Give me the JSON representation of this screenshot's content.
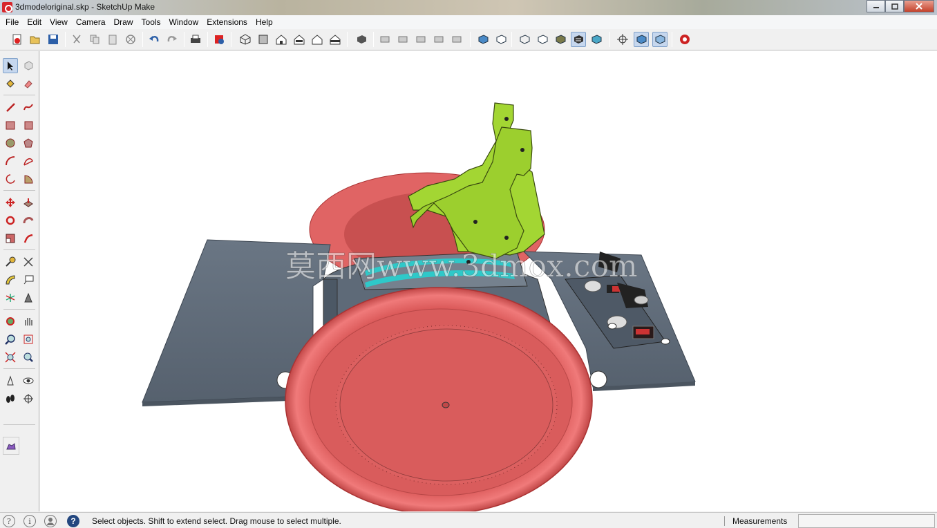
{
  "window": {
    "title": "3dmodeloriginal.skp - SketchUp Make",
    "buttons": [
      "minimize",
      "maximize",
      "close"
    ]
  },
  "menu": [
    "File",
    "Edit",
    "View",
    "Camera",
    "Draw",
    "Tools",
    "Window",
    "Extensions",
    "Help"
  ],
  "toolbar": {
    "groups": [
      [
        "new-icon",
        "open-icon",
        "save-icon"
      ],
      [
        "cut-icon",
        "copy-icon",
        "paste-icon",
        "erase-icon"
      ],
      [
        "undo-icon",
        "redo-icon"
      ],
      [
        "print-icon"
      ],
      [
        "model-info-icon"
      ],
      [
        "iso-view-icon",
        "top-view-icon",
        "front-view-icon",
        "right-view-icon",
        "back-view-icon",
        "left-view-icon"
      ],
      [
        "components-icon"
      ],
      [
        "tools-1-icon",
        "tools-2-icon",
        "tools-3-icon",
        "tools-4-icon",
        "tools-5-icon"
      ],
      [
        "xray-icon",
        "back-edges-icon"
      ],
      [
        "wireframe-icon",
        "hidden-line-icon",
        "shaded-icon",
        "shaded-textures-icon",
        "monochrome-icon"
      ],
      [
        "section-plane-icon",
        "display-section-planes-icon",
        "display-section-cuts-icon"
      ],
      [
        "extension-warehouse-icon"
      ]
    ]
  },
  "lefttoolbar": {
    "tools": [
      "select-icon",
      "make-component-icon",
      "paint-bucket-icon",
      "eraser-icon",
      "line-icon",
      "freehand-icon",
      "rectangle-icon",
      "rotated-rectangle-icon",
      "circle-icon",
      "polygon-icon",
      "arc-icon",
      "2pt-arc-icon",
      "3pt-arc-icon",
      "pie-icon",
      "move-icon",
      "push-pull-icon",
      "rotate-icon",
      "follow-me-icon",
      "scale-icon",
      "offset-icon",
      "tape-measure-icon",
      "dimension-icon",
      "protractor-icon",
      "text-icon",
      "axes-icon",
      "3d-text-icon",
      "orbit-icon",
      "pan-icon",
      "zoom-icon",
      "zoom-window-icon",
      "zoom-extents-icon",
      "previous-view-icon",
      "position-camera-icon",
      "look-around-icon",
      "walk-icon",
      "section-plane-icon",
      "sandbox-icon"
    ]
  },
  "canvas": {
    "watermark": "莫西网www.3dmox.com"
  },
  "status": {
    "hint": "Select objects. Shift to extend select. Drag mouse to select multiple.",
    "measurements_label": "Measurements",
    "measurements_value": ""
  },
  "colors": {
    "wheel": "#e06464",
    "wheel_face": "#d95c5c",
    "plate": "#5d6a78",
    "bracket": "#a3d633",
    "panel_glass": "#2ec9c9"
  }
}
